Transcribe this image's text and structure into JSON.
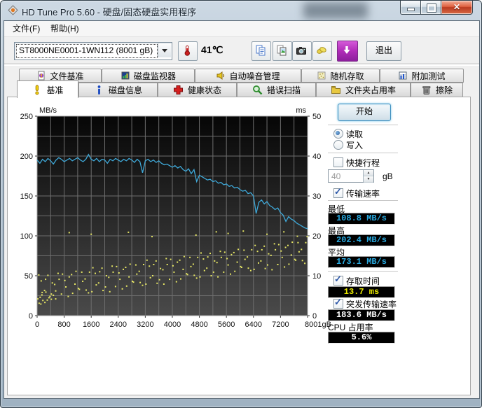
{
  "window": {
    "title": "HD Tune Pro 5.60 - 硬盘/固态硬盘实用程序",
    "caption_buttons": {
      "minimize": "minimize",
      "maximize": "maximize",
      "close": "close"
    }
  },
  "menu": {
    "items": [
      {
        "label": "文件(F)"
      },
      {
        "label": "帮助(H)"
      }
    ]
  },
  "toolbar": {
    "drive_select": "ST8000NE0001-1WN112 (8001 gB)",
    "temperature": "41℃",
    "buttons": [
      "copy-text",
      "copy-image",
      "screenshot",
      "donate",
      "download"
    ],
    "exit_label": "退出"
  },
  "tabs_top": [
    {
      "label": "文件基准",
      "icon": "file-benchmark-icon"
    },
    {
      "label": "磁盘监视器",
      "icon": "disk-monitor-icon"
    },
    {
      "label": "自动噪音管理",
      "icon": "aam-icon"
    },
    {
      "label": "随机存取",
      "icon": "random-access-icon"
    },
    {
      "label": "附加测试",
      "icon": "extra-tests-icon"
    }
  ],
  "tabs_bottom": [
    {
      "label": "基准",
      "icon": "benchmark-icon",
      "active": true
    },
    {
      "label": "磁盘信息",
      "icon": "info-icon",
      "active": false
    },
    {
      "label": "健康状态",
      "icon": "health-icon",
      "active": false
    },
    {
      "label": "错误扫描",
      "icon": "error-scan-icon",
      "active": false
    },
    {
      "label": "文件夹占用率",
      "icon": "folder-usage-icon",
      "active": false
    },
    {
      "label": "擦除",
      "icon": "erase-icon",
      "active": false
    }
  ],
  "controls": {
    "start_label": "开始",
    "read_label": "读取",
    "read_dot": "●",
    "write_label": "写入",
    "write_dot": "",
    "short_stroke_label": "快捷行程",
    "short_stroke_check": "",
    "capacity_value": "40",
    "capacity_unit": "gB",
    "transfer_rate_label": "传输速率",
    "transfer_rate_check": "✓",
    "min_label": "最低",
    "min_value": "108.8 MB/s",
    "max_label": "最高",
    "max_value": "202.4 MB/s",
    "avg_label": "平均",
    "avg_value": "173.1 MB/s",
    "access_time_label": "存取时间",
    "access_time_check": "✓",
    "access_time_value": "13.7 ms",
    "burst_rate_label": "突发传输速率",
    "burst_rate_check": "✓",
    "burst_rate_value": "183.6 MB/s",
    "cpu_usage_label": "CPU 占用率",
    "cpu_usage_value": "5.6%"
  },
  "colors": {
    "lcd_cyan": "#29abe2",
    "lcd_yellow": "#e8e800",
    "lcd_white": "#ffffff",
    "line_blue": "#3fa9d9",
    "scatter_yellow": "#e6e664",
    "download_purple": "#b02cb8",
    "close_red": "#d2422f"
  },
  "chart_data": {
    "type": "line+scatter",
    "title": "",
    "x_axis": {
      "max": 8001,
      "grid_step": 400,
      "ticks": [
        {
          "v": 0,
          "t": "0"
        },
        {
          "v": 800,
          "t": "800"
        },
        {
          "v": 1600,
          "t": "1600"
        },
        {
          "v": 2400,
          "t": "2400"
        },
        {
          "v": 3200,
          "t": "3200"
        },
        {
          "v": 4000,
          "t": "4000"
        },
        {
          "v": 4800,
          "t": "4800"
        },
        {
          "v": 5600,
          "t": "5600"
        },
        {
          "v": 6400,
          "t": "6400"
        },
        {
          "v": 7200,
          "t": "7200"
        },
        {
          "v": 8001,
          "t": "8001gB"
        }
      ]
    },
    "y_left": {
      "label": "MB/s",
      "min": 0,
      "max": 250,
      "grid_step": 25,
      "ticks": [
        0,
        50,
        100,
        150,
        200,
        250
      ]
    },
    "y_right": {
      "label": "ms",
      "min": 0,
      "max": 50,
      "ticks": [
        0,
        10,
        20,
        30,
        40,
        50
      ]
    },
    "series": [
      {
        "name": "transfer-rate",
        "type": "line",
        "axis": "left",
        "color": "#3fa9d9",
        "x_step": 80,
        "y": [
          195,
          191,
          196,
          193,
          197,
          194,
          190,
          195,
          198,
          196,
          193,
          195,
          197,
          194,
          196,
          198,
          195,
          193,
          196,
          202,
          196,
          194,
          197,
          193,
          196,
          195,
          191,
          196,
          194,
          197,
          195,
          193,
          196,
          194,
          197,
          195,
          192,
          196,
          193,
          179,
          194,
          196,
          193,
          195,
          192,
          194,
          191,
          189,
          190,
          188,
          186,
          188,
          185,
          187,
          183,
          181,
          184,
          178,
          183,
          168,
          176,
          174,
          172,
          170,
          171,
          168,
          169,
          166,
          167,
          164,
          165,
          162,
          163,
          160,
          161,
          158,
          156,
          157,
          153,
          154,
          150,
          128,
          142,
          145,
          140,
          143,
          138,
          136,
          133,
          135,
          129,
          126,
          118,
          124,
          121,
          119,
          116,
          114,
          112,
          110,
          109
        ]
      },
      {
        "name": "access-time",
        "type": "scatter",
        "axis": "right",
        "color": "#e6e664",
        "points": [
          [
            20,
            4.2
          ],
          [
            50,
            10.2
          ],
          [
            120,
            8.7
          ],
          [
            150,
            5.8
          ],
          [
            220,
            6.3
          ],
          [
            250,
            9.1
          ],
          [
            320,
            10.1
          ],
          [
            350,
            4.5
          ],
          [
            420,
            5.4
          ],
          [
            450,
            8.2
          ],
          [
            520,
            7.8
          ],
          [
            550,
            4.2
          ],
          [
            620,
            10.6
          ],
          [
            650,
            9.1
          ],
          [
            720,
            5.4
          ],
          [
            750,
            10.4
          ],
          [
            820,
            8.8
          ],
          [
            850,
            7.2
          ],
          [
            920,
            4.8
          ],
          [
            950,
            9.7
          ],
          [
            1020,
            10.3
          ],
          [
            1050,
            5.6
          ],
          [
            1120,
            7.9
          ],
          [
            1150,
            11.1
          ],
          [
            1220,
            6.8
          ],
          [
            1250,
            6.6
          ],
          [
            1320,
            10.9
          ],
          [
            1350,
            8.6
          ],
          [
            1420,
            9.2
          ],
          [
            1450,
            6.4
          ],
          [
            1520,
            5.7
          ],
          [
            1550,
            10.9
          ],
          [
            1620,
            6.0
          ],
          [
            1650,
            12.0
          ],
          [
            1720,
            10.6
          ],
          [
            1750,
            7.7
          ],
          [
            1820,
            8.2
          ],
          [
            1850,
            11.0
          ],
          [
            1920,
            11.9
          ],
          [
            1950,
            6.3
          ],
          [
            2020,
            7.2
          ],
          [
            2050,
            10.0
          ],
          [
            2120,
            9.6
          ],
          [
            2150,
            6.0
          ],
          [
            2220,
            12.4
          ],
          [
            2250,
            10.9
          ],
          [
            2320,
            7.3
          ],
          [
            2350,
            12.3
          ],
          [
            2420,
            10.7
          ],
          [
            2450,
            9.1
          ],
          [
            2520,
            6.7
          ],
          [
            2550,
            11.6
          ],
          [
            2620,
            12.1
          ],
          [
            2650,
            7.4
          ],
          [
            2720,
            9.7
          ],
          [
            2750,
            12.9
          ],
          [
            2820,
            8.6
          ],
          [
            2850,
            8.4
          ],
          [
            2920,
            12.7
          ],
          [
            2950,
            10.4
          ],
          [
            3020,
            11.1
          ],
          [
            3050,
            8.3
          ],
          [
            3120,
            7.6
          ],
          [
            3150,
            12.8
          ],
          [
            3220,
            7.9
          ],
          [
            3250,
            13.9
          ],
          [
            3320,
            12.4
          ],
          [
            3350,
            9.5
          ],
          [
            3420,
            10.0
          ],
          [
            3450,
            12.8
          ],
          [
            3520,
            13.7
          ],
          [
            3550,
            8.1
          ],
          [
            3620,
            9.0
          ],
          [
            3650,
            11.8
          ],
          [
            3720,
            11.5
          ],
          [
            3750,
            7.9
          ],
          [
            3820,
            14.3
          ],
          [
            3850,
            12.8
          ],
          [
            3920,
            9.1
          ],
          [
            3950,
            14.1
          ],
          [
            4020,
            12.5
          ],
          [
            4050,
            10.9
          ],
          [
            4120,
            8.5
          ],
          [
            4150,
            13.4
          ],
          [
            4220,
            13.9
          ],
          [
            4250,
            9.2
          ],
          [
            4320,
            11.6
          ],
          [
            4350,
            14.8
          ],
          [
            4420,
            10.5
          ],
          [
            4450,
            10.3
          ],
          [
            4520,
            14.6
          ],
          [
            4550,
            12.3
          ],
          [
            4620,
            12.9
          ],
          [
            4650,
            10.1
          ],
          [
            4720,
            9.4
          ],
          [
            4750,
            14.6
          ],
          [
            4820,
            9.7
          ],
          [
            4850,
            15.7
          ],
          [
            4920,
            14.2
          ],
          [
            4950,
            11.3
          ],
          [
            5020,
            11.9
          ],
          [
            5050,
            14.7
          ],
          [
            5120,
            15.6
          ],
          [
            5150,
            10.0
          ],
          [
            5220,
            10.9
          ],
          [
            5250,
            13.7
          ],
          [
            5320,
            13.3
          ],
          [
            5350,
            9.7
          ],
          [
            5420,
            16.1
          ],
          [
            5450,
            14.6
          ],
          [
            5520,
            10.9
          ],
          [
            5550,
            15.9
          ],
          [
            5620,
            14.3
          ],
          [
            5650,
            12.7
          ],
          [
            5720,
            10.4
          ],
          [
            5750,
            15.3
          ],
          [
            5820,
            15.8
          ],
          [
            5850,
            11.1
          ],
          [
            5920,
            13.4
          ],
          [
            5950,
            16.6
          ],
          [
            6020,
            12.3
          ],
          [
            6050,
            12.1
          ],
          [
            6120,
            16.4
          ],
          [
            6150,
            14.1
          ],
          [
            6220,
            14.7
          ],
          [
            6250,
            11.9
          ],
          [
            6320,
            11.3
          ],
          [
            6350,
            16.5
          ],
          [
            6420,
            11.6
          ],
          [
            6450,
            17.6
          ],
          [
            6520,
            16.1
          ],
          [
            6550,
            13.2
          ],
          [
            6620,
            13.7
          ],
          [
            6650,
            16.5
          ],
          [
            6720,
            17.4
          ],
          [
            6750,
            11.8
          ],
          [
            6820,
            12.7
          ],
          [
            6850,
            15.5
          ],
          [
            6920,
            15.1
          ],
          [
            6950,
            11.5
          ],
          [
            7020,
            18.0
          ],
          [
            7050,
            16.5
          ],
          [
            7120,
            12.8
          ],
          [
            7150,
            17.8
          ],
          [
            7220,
            16.2
          ],
          [
            7250,
            14.6
          ],
          [
            7320,
            12.2
          ],
          [
            7350,
            17.1
          ],
          [
            7420,
            17.6
          ],
          [
            7450,
            12.9
          ],
          [
            7520,
            15.2
          ],
          [
            7550,
            18.4
          ],
          [
            7620,
            14.1
          ],
          [
            7650,
            13.9
          ],
          [
            7720,
            18.3
          ],
          [
            7750,
            16.0
          ],
          [
            7820,
            16.6
          ],
          [
            7850,
            13.8
          ],
          [
            7920,
            13.1
          ],
          [
            7950,
            18.3
          ],
          [
            60,
            3.1
          ],
          [
            110,
            2.9
          ],
          [
            170,
            3.8
          ],
          [
            230,
            3.3
          ],
          [
            90,
            4.6
          ],
          [
            300,
            3.9
          ],
          [
            380,
            4.8
          ],
          [
            140,
            5.2
          ],
          [
            260,
            5.9
          ],
          [
            420,
            4.1
          ],
          [
            480,
            5.1
          ],
          [
            550,
            6.2
          ],
          [
            950,
            20.8
          ],
          [
            1600,
            20.4
          ],
          [
            2700,
            20.9
          ],
          [
            3400,
            19.8
          ],
          [
            4700,
            20.2
          ],
          [
            5300,
            21.0
          ],
          [
            5650,
            20.6
          ],
          [
            6100,
            21.2
          ],
          [
            6800,
            20.4
          ],
          [
            7300,
            21.0
          ],
          [
            7700,
            19.9
          ],
          [
            7990,
            19.8
          ]
        ]
      }
    ]
  }
}
